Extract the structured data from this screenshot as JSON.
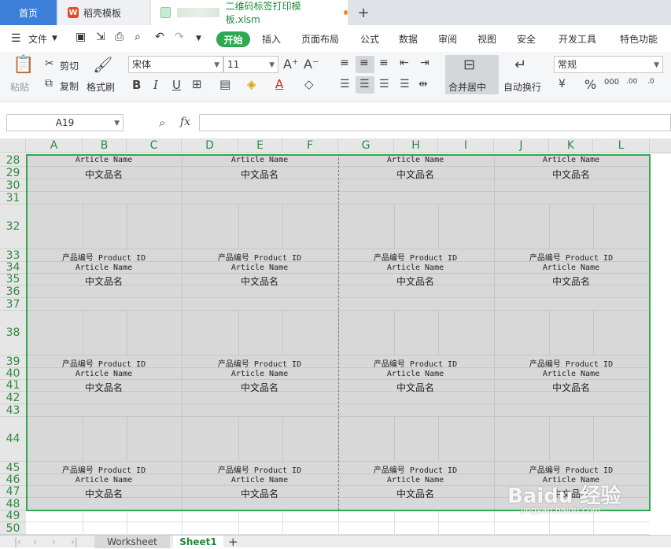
{
  "tabs": {
    "home": "首页",
    "shell": "稻壳模板",
    "file": "二维码标签打印模板.xlsm",
    "shell_logo": "W"
  },
  "menu": {
    "file": "文件",
    "start": "开始",
    "items": [
      "插入",
      "页面布局",
      "公式",
      "数据",
      "审阅",
      "视图",
      "安全",
      "开发工具",
      "特色功能"
    ]
  },
  "ribbon": {
    "paste": "粘贴",
    "cut": "剪切",
    "copy": "复制",
    "format_painter": "格式刷",
    "font_name": "宋体",
    "font_size": "11",
    "merge_center": "合并居中",
    "wrap_text": "自动换行",
    "number_format": "常规",
    "bold": "B",
    "italic": "I",
    "underline": "U"
  },
  "formula_bar": {
    "name_box": "A19",
    "fx": "fx",
    "value": ""
  },
  "columns": [
    "A",
    "B",
    "C",
    "D",
    "E",
    "F",
    "G",
    "H",
    "I",
    "J",
    "K",
    "L"
  ],
  "rows": [
    "28",
    "29",
    "30",
    "31",
    "32",
    "33",
    "34",
    "35",
    "36",
    "37",
    "38",
    "39",
    "40",
    "41",
    "42",
    "43",
    "44",
    "45",
    "46",
    "47",
    "48",
    "49",
    "50"
  ],
  "label": {
    "product_id": "产品编号 Product ID",
    "article_name": "Article Name",
    "chinese_name": "中文品名"
  },
  "sheets": {
    "worksheet": "Worksheet",
    "sheet1": "Sheet1"
  },
  "watermark": {
    "brand": "Baidu 经验",
    "url": "jingyan.baidu.com"
  },
  "colors": {
    "accent": "#2fa84f",
    "home_tab": "#3b7fd9",
    "cell_fill": "#d8d8d8"
  }
}
